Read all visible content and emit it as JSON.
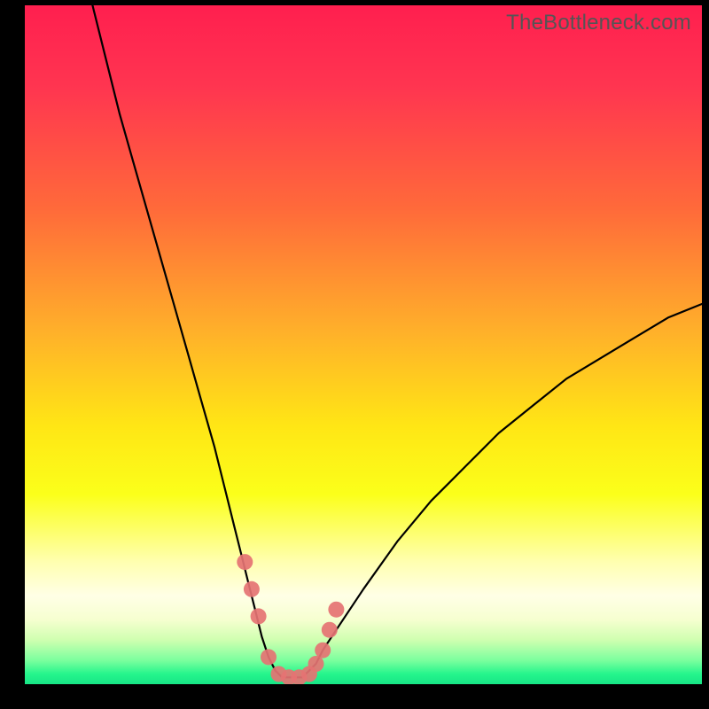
{
  "watermark": "TheBottleneck.com",
  "chart_data": {
    "type": "line",
    "title": "",
    "xlabel": "",
    "ylabel": "",
    "xlim": [
      0,
      100
    ],
    "ylim": [
      0,
      100
    ],
    "grid": false,
    "legend": false,
    "gradient_stops": [
      {
        "pos": 0.0,
        "color": "#ff1f4f"
      },
      {
        "pos": 0.12,
        "color": "#ff3550"
      },
      {
        "pos": 0.3,
        "color": "#ff6a3a"
      },
      {
        "pos": 0.48,
        "color": "#ffb02a"
      },
      {
        "pos": 0.62,
        "color": "#ffe615"
      },
      {
        "pos": 0.72,
        "color": "#fbff1a"
      },
      {
        "pos": 0.82,
        "color": "#ffffb0"
      },
      {
        "pos": 0.87,
        "color": "#ffffe6"
      },
      {
        "pos": 0.905,
        "color": "#f6ffd0"
      },
      {
        "pos": 0.935,
        "color": "#cfffb0"
      },
      {
        "pos": 0.965,
        "color": "#7bff9e"
      },
      {
        "pos": 0.985,
        "color": "#25f58c"
      },
      {
        "pos": 1.0,
        "color": "#17e586"
      }
    ],
    "series": [
      {
        "name": "bottleneck-curve",
        "color": "#000000",
        "x": [
          10,
          12,
          14,
          16,
          18,
          20,
          22,
          24,
          26,
          28,
          30,
          31,
          32,
          33,
          34,
          35,
          36,
          37,
          38,
          39,
          40,
          41,
          42,
          43,
          44,
          46,
          50,
          55,
          60,
          65,
          70,
          75,
          80,
          85,
          90,
          95,
          100
        ],
        "y": [
          100,
          92,
          84,
          77,
          70,
          63,
          56,
          49,
          42,
          35,
          27,
          23,
          19,
          15,
          11,
          7,
          4,
          2,
          1,
          1,
          1,
          1,
          2,
          3,
          5,
          8,
          14,
          21,
          27,
          32,
          37,
          41,
          45,
          48,
          51,
          54,
          56
        ]
      },
      {
        "name": "highlight-markers",
        "color": "#e57373",
        "marker_size": 18,
        "type": "scatter",
        "x": [
          32.5,
          33.5,
          34.5,
          36.0,
          37.5,
          39.0,
          40.5,
          42.0,
          43.0,
          44.0,
          45.0,
          46.0
        ],
        "y": [
          18,
          14,
          10,
          4,
          1.5,
          1,
          1,
          1.5,
          3,
          5,
          8,
          11
        ]
      }
    ],
    "annotations": []
  }
}
